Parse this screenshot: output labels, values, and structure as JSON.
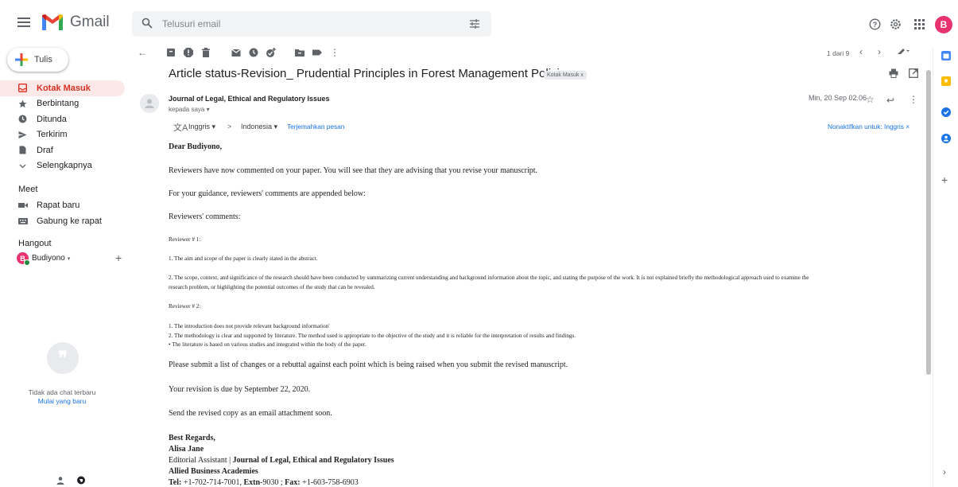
{
  "app": {
    "name": "Gmail"
  },
  "search": {
    "placeholder": "Telusuri email"
  },
  "header": {
    "avatar_letter": "B"
  },
  "sidebar": {
    "compose_label": "Tulis",
    "items": [
      {
        "label": "Kotak Masuk",
        "icon": "inbox-icon",
        "active": true
      },
      {
        "label": "Berbintang",
        "icon": "star-icon"
      },
      {
        "label": "Ditunda",
        "icon": "clock-icon"
      },
      {
        "label": "Terkirim",
        "icon": "send-icon"
      },
      {
        "label": "Draf",
        "icon": "draft-icon"
      },
      {
        "label": "Selengkapnya",
        "icon": "chevron-down-icon"
      }
    ],
    "meet_title": "Meet",
    "meet_items": [
      {
        "label": "Rapat baru",
        "icon": "video-icon"
      },
      {
        "label": "Gabung ke rapat",
        "icon": "keyboard-icon"
      }
    ],
    "hangout_title": "Hangout",
    "hangout_user": "Budiyono",
    "hangout_user_suffix": "▾",
    "hangout_avatar": "B",
    "no_chat_text": "Tidak ada chat terbaru",
    "start_new_link": "Mulai yang baru"
  },
  "toolbar": {
    "pager_text": "1 dari 9"
  },
  "email": {
    "subject": "Article status-Revision_ Prudential Principles in Forest Management Policies",
    "label_chip": "Kotak Masuk x",
    "sender": "Journal of Legal, Ethical and Regulatory Issues",
    "to": "kepada saya ▾",
    "date": "Min, 20 Sep 02.06",
    "translate": {
      "from": "Inggris ▾",
      "arrow": ">",
      "to": "Indonesia ▾",
      "link": "Terjemahkan pesan",
      "disable": "Nonaktifkan untuk: Inggris ×"
    },
    "greeting": "Dear Budiyono,",
    "p1": "Reviewers have now commented on your paper. You will see that they are advising that you revise your manuscript.",
    "p2": "For your guidance, reviewers' comments are appended below:",
    "p3": "Reviewers' comments:",
    "r1_title": "Reviewer # 1:",
    "r1_1": "1. The aim and scope of the paper is clearly stated in the abstract.",
    "r1_2a": "2. The scope, context, and significance of the research should have been conducted by summarizing current understanding and background information about the topic, and stating the purpose of the work.  It is not explained briefly the methodological approach used to examine the",
    "r1_2b": "research problem, or highlighting the potential outcomes of the study that can be revealed.",
    "r2_title": "Reviewer # 2:",
    "r2_1": "1. The introduction does not provide relevant background information'",
    "r2_2": "2. The methodology is clear and supported by literature. The method used is appropriate to the objective of the study and it is reliable for the interpretation of results and findings.",
    "r2_3": "• The literature is based on various studies and integrated within the body of the paper.",
    "p4": "Please submit a list of changes or a rebuttal against each point which is being raised when you submit the revised manuscript.",
    "p5": "Your revision is due by September 22, 2020.",
    "p6": "Send the revised copy as an email attachment soon.",
    "sig_regards": "Best Regards,",
    "sig_name": "Alisa Jane",
    "sig_role": "Editorial Assistant | ",
    "sig_journal": "Journal of Legal, Ethical and Regulatory Issues",
    "sig_org": "Allied Business Academies",
    "sig_tel_label": "Tel:",
    "sig_tel": " +1-702-714-7001, ",
    "sig_extn_label": "Extn",
    "sig_extn": "-9030 ; ",
    "sig_fax_label": "Fax:",
    "sig_fax": " +1-603-758-6903"
  },
  "colors": {
    "accent": "#ea4335",
    "active_bg": "#fce8e6",
    "link": "#1a73e8",
    "avatar": "#e8336e"
  }
}
